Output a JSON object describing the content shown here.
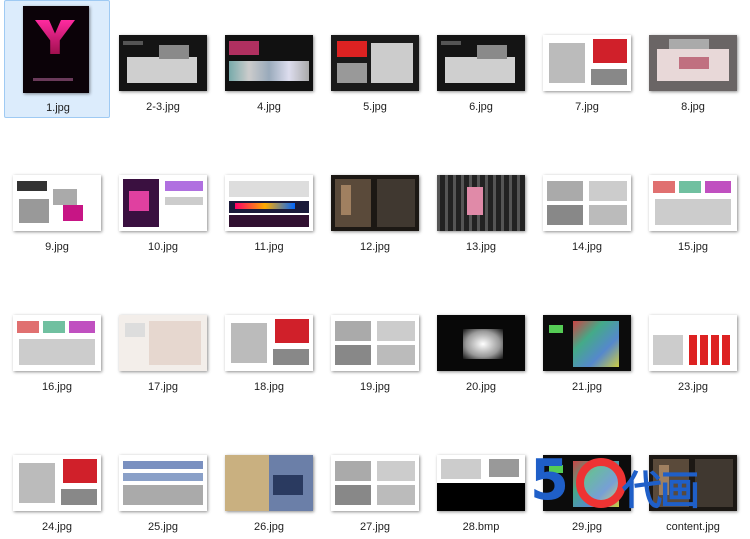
{
  "files": [
    {
      "name": "1.jpg",
      "thumb": "portrait",
      "style": "magenta-cover",
      "selected": true
    },
    {
      "name": "2-3.jpg",
      "thumb": "land",
      "style": "dark-model"
    },
    {
      "name": "4.jpg",
      "thumb": "land",
      "style": "dark-strip"
    },
    {
      "name": "5.jpg",
      "thumb": "land",
      "style": "dark-red"
    },
    {
      "name": "6.jpg",
      "thumb": "land",
      "style": "dark-model"
    },
    {
      "name": "7.jpg",
      "thumb": "land",
      "style": "white-red"
    },
    {
      "name": "8.jpg",
      "thumb": "land",
      "style": "photo-model"
    },
    {
      "name": "9.jpg",
      "thumb": "land",
      "style": "white-magenta"
    },
    {
      "name": "10.jpg",
      "thumb": "land",
      "style": "white-purple"
    },
    {
      "name": "11.jpg",
      "thumb": "land",
      "style": "white-dark-bands"
    },
    {
      "name": "12.jpg",
      "thumb": "land",
      "style": "dark-photo"
    },
    {
      "name": "13.jpg",
      "thumb": "land",
      "style": "dark-grid"
    },
    {
      "name": "14.jpg",
      "thumb": "land",
      "style": "white-gray"
    },
    {
      "name": "15.jpg",
      "thumb": "land",
      "style": "white-color"
    },
    {
      "name": "16.jpg",
      "thumb": "land",
      "style": "white-color"
    },
    {
      "name": "17.jpg",
      "thumb": "land",
      "style": "white-soft"
    },
    {
      "name": "18.jpg",
      "thumb": "land",
      "style": "white-red"
    },
    {
      "name": "19.jpg",
      "thumb": "land",
      "style": "white-gray"
    },
    {
      "name": "20.jpg",
      "thumb": "land",
      "style": "dark-glow"
    },
    {
      "name": "21.jpg",
      "thumb": "land",
      "style": "dark-color"
    },
    {
      "name": "23.jpg",
      "thumb": "land",
      "style": "white-red-grid"
    },
    {
      "name": "24.jpg",
      "thumb": "land",
      "style": "white-red"
    },
    {
      "name": "25.jpg",
      "thumb": "land",
      "style": "white-blue"
    },
    {
      "name": "26.jpg",
      "thumb": "land",
      "style": "photo-city"
    },
    {
      "name": "27.jpg",
      "thumb": "land",
      "style": "white-gray"
    },
    {
      "name": "28.bmp",
      "thumb": "land",
      "style": "half-dark"
    },
    {
      "name": "29.jpg",
      "thumb": "land",
      "style": "dark-color"
    },
    {
      "name": "content.jpg",
      "thumb": "land",
      "style": "dark-photo"
    }
  ],
  "watermark": {
    "digits": "5",
    "text": "代画"
  },
  "colors": {
    "selection_bg": "#dcecfc",
    "selection_border": "#9fcaf3",
    "watermark_blue": "#1f5fc8",
    "watermark_red": "#ee3333"
  }
}
